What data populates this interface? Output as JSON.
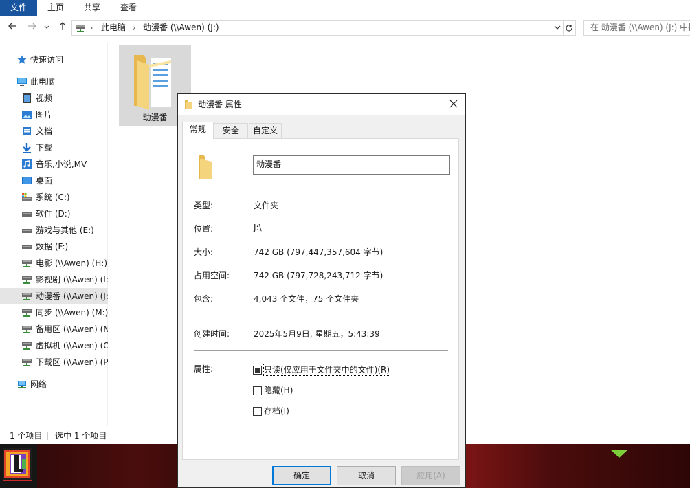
{
  "ribbon": {
    "tabs": [
      "文件",
      "主页",
      "共享",
      "查看"
    ]
  },
  "address": {
    "segments": [
      "此电脑",
      "动漫番 (\\\\Awen) (J:)"
    ],
    "search_placeholder": "在 动漫番 (\\\\Awen) (J:) 中搜"
  },
  "sidebar": {
    "quick_access": "快速访问",
    "this_pc": "此电脑",
    "items": [
      "视频",
      "图片",
      "文档",
      "下载",
      "音乐,小说,MV",
      "桌面",
      "系统 (C:)",
      "软件 (D:)",
      "游戏与其他 (E:)",
      "数据 (F:)",
      "电影 (\\\\Awen) (H:)",
      "影视剧 (\\\\Awen) (I:)",
      "动漫番 (\\\\Awen) (J:)",
      "同步 (\\\\Awen) (M:)",
      "备用区 (\\\\Awen) (N:)",
      "虚拟机 (\\\\Awen) (O:)",
      "下载区 (\\\\Awen) (P:)"
    ],
    "network": "网络"
  },
  "main": {
    "folder_name": "动漫番"
  },
  "status": {
    "count": "1 个项目",
    "selected": "选中 1 个项目"
  },
  "dialog": {
    "title": "动漫番 属性",
    "tabs": [
      "常规",
      "安全",
      "自定义"
    ],
    "name_value": "动漫番",
    "labels": {
      "type": "类型:",
      "location": "位置:",
      "size": "大小:",
      "size_on_disk": "占用空间:",
      "contains": "包含:",
      "created": "创建时间:",
      "attributes": "属性:"
    },
    "values": {
      "type": "文件夹",
      "location": "J:\\",
      "size": "742 GB (797,447,357,604 字节)",
      "size_on_disk": "742 GB (797,728,243,712 字节)",
      "contains": "4,043 个文件，75 个文件夹",
      "created": "2025年5月9日, 星期五，5:43:39"
    },
    "attributes": {
      "readonly": "只读(仅应用于文件夹中的文件)(R)",
      "hidden": "隐藏(H)",
      "archive": "存档(I)"
    },
    "buttons": {
      "ok": "确定",
      "cancel": "取消",
      "apply": "应用(A)"
    }
  },
  "colors": {
    "accent": "#0078d7",
    "file_tab": "#19549f",
    "folder_yellow": "#f4d47c"
  }
}
